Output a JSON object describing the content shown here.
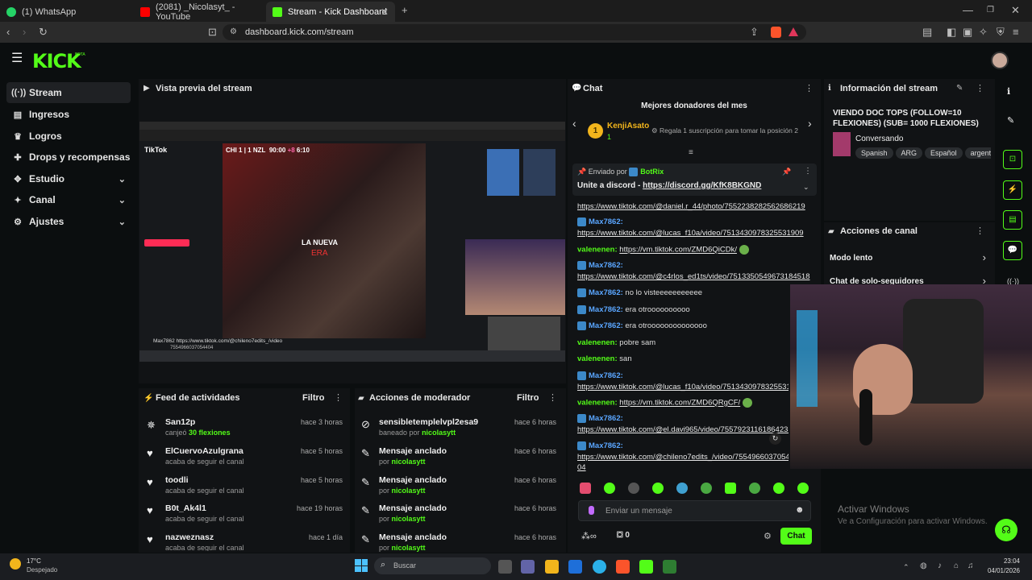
{
  "tabs": [
    {
      "label": "(1) WhatsApp",
      "icon": "whatsapp-icon"
    },
    {
      "label": "(2081) _Nicolasyt_ - YouTube",
      "icon": "youtube-icon"
    },
    {
      "label": "Stream - Kick Dashboard",
      "icon": "kick-icon"
    }
  ],
  "address": {
    "url": "dashboard.kick.com/stream"
  },
  "kick": {
    "logo": "KICK",
    "beta": "BETA"
  },
  "sidebar": {
    "items": [
      {
        "label": "Stream",
        "icon": "broadcast-icon"
      },
      {
        "label": "Ingresos",
        "icon": "wallet-icon"
      },
      {
        "label": "Logros",
        "icon": "trophy-icon"
      },
      {
        "label": "Drops y recompensas",
        "icon": "gift-icon"
      },
      {
        "label": "Estudio",
        "icon": "studio-icon"
      },
      {
        "label": "Canal",
        "icon": "channel-icon"
      },
      {
        "label": "Ajustes",
        "icon": "gear-icon"
      }
    ]
  },
  "preview": {
    "title": "Vista previa del stream",
    "score": {
      "team1": "CHI",
      "s1": "1",
      "s2": "1",
      "team2": "NZL",
      "clock": "90:00",
      "added": "+8",
      "extra": "6:10"
    },
    "overlay1": "LA NUEVA",
    "overlay2": "ERA",
    "tiktok": "TikTok",
    "chatline_user": "Max7862",
    "chatline_link": "https://www.tiktok.com/@chileno7edits_/video",
    "chatline_link2": "7554966037054404"
  },
  "feed": {
    "title": "Feed de actividades",
    "filter": "Filtro",
    "items": [
      {
        "name": "San12p",
        "sub_pre": "canjeó",
        "sub_hl": "30 flexiones",
        "time": "hace 3 horas"
      },
      {
        "name": "ElCuervoAzulgrana",
        "sub": "acaba de seguir el canal",
        "time": "hace 5 horas"
      },
      {
        "name": "toodli",
        "sub": "acaba de seguir el canal",
        "time": "hace 5 horas"
      },
      {
        "name": "B0t_Ak4l1",
        "sub": "acaba de seguir el canal",
        "time": "hace 19 horas"
      },
      {
        "name": "nazweznasz",
        "sub": "acaba de seguir el canal",
        "time": "hace 1 día"
      }
    ]
  },
  "modactions": {
    "title": "Acciones de moderador",
    "filter": "Filtro",
    "items": [
      {
        "name": "sensibletemplelvpl2esa9",
        "sub_pre": "baneado por",
        "by": "nicolasytt",
        "time": "hace 6 horas"
      },
      {
        "name": "Mensaje anclado",
        "sub_pre": "por",
        "by": "nicolasytt",
        "time": "hace 6 horas"
      },
      {
        "name": "Mensaje anclado",
        "sub_pre": "por",
        "by": "nicolasytt",
        "time": "hace 6 horas"
      },
      {
        "name": "Mensaje anclado",
        "sub_pre": "por",
        "by": "nicolasytt",
        "time": "hace 6 horas"
      },
      {
        "name": "Mensaje anclado",
        "sub_pre": "por",
        "by": "nicolasytt",
        "time": "hace 6 horas"
      }
    ]
  },
  "chat": {
    "title": "Chat",
    "donors_title": "Mejores donadores del mes",
    "donor_rank": "1",
    "donor_name": "KenjiAsato",
    "donor_count": "1",
    "donor_prompt": "Regala 1 suscripción para tomar la posición 2",
    "pinned_by": "Enviado por",
    "pinned_user": "BotRix",
    "pinned_text": "Unite a discord -",
    "pinned_link": "https://discord.gg/KfK8BKGND",
    "lines": [
      {
        "user": "",
        "text": "https://www.tiktok.com/@daniel.r_44/photo/7552238282562686219"
      },
      {
        "user": "Max7862:",
        "text": ""
      },
      {
        "user": "",
        "text": "https://www.tiktok.com/@lucas_f10a/video/7513430978325531909"
      },
      {
        "user": "valenenen:",
        "text": "https://vm.tiktok.com/ZMD6QiCDk/"
      },
      {
        "user": "Max7862:",
        "text": ""
      },
      {
        "user": "",
        "text": "https://www.tiktok.com/@c4rlos_ed1ts/video/7513350549673184518"
      },
      {
        "user": "Max7862:",
        "text": "no lo visteeeeeeeeeee"
      },
      {
        "user": "Max7862:",
        "text": "era otroooooooooo"
      },
      {
        "user": "Max7862:",
        "text": "era otroooooooooooooo"
      },
      {
        "user": "valenenen:",
        "text": "pobre sam"
      },
      {
        "user": "valenenen:",
        "text": "san"
      },
      {
        "user": "Max7862:",
        "text": ""
      },
      {
        "user": "",
        "text": "https://www.tiktok.com/@lucas_f10a/video/7513430978325531909"
      },
      {
        "user": "valenenen:",
        "text": "https://vm.tiktok.com/ZMD6QRgCF/"
      },
      {
        "user": "Max7862:",
        "text": ""
      },
      {
        "user": "",
        "text": "https://www.tiktok.com/@el.davi965/video/7557923116186423556"
      },
      {
        "user": "Max7862:",
        "text": ""
      },
      {
        "user": "",
        "text": "https://www.tiktok.com/@chileno7edits_/video/7554966037054"
      },
      {
        "user": "",
        "text": "04"
      }
    ],
    "input_placeholder": "Enviar un mensaje",
    "points": "0",
    "send": "Chat"
  },
  "info": {
    "title": "Información del stream",
    "stream_title": "VIENDO DOC TOPS (FOLLOW=10 FLEXIONES) (SUB= 1000 FLEXIONES)",
    "category": "Conversando",
    "tags": [
      "Spanish",
      "ARG",
      "Español",
      "argentin"
    ]
  },
  "channel_actions": {
    "title": "Acciones de canal",
    "items": [
      "Modo lento",
      "Chat de solo-seguidores"
    ]
  },
  "watermark": {
    "line1": "Activar Windows",
    "line2": "Ve a Configuración para activar Windows."
  },
  "taskbar": {
    "weather_temp": "17°C",
    "weather_text": "Despejado",
    "search": "Buscar",
    "time": "23:04",
    "date": "04/01/2026"
  },
  "colors": {
    "accent": "#53fc18",
    "bg": "#0b0e0f",
    "panel": "#111315"
  }
}
